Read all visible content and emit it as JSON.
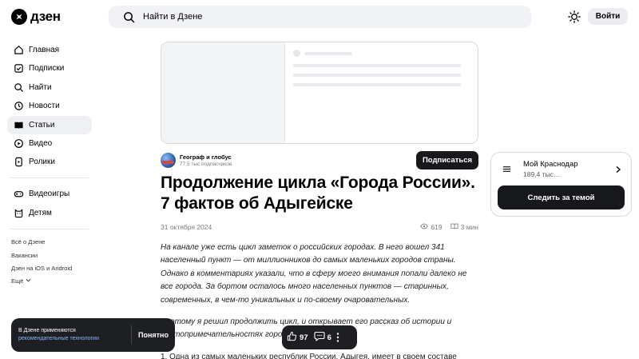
{
  "header": {
    "logo_text": "дзен",
    "search_placeholder": "Найти в Дзене",
    "login_label": "Войти"
  },
  "sidebar": {
    "items": [
      {
        "label": "Главная",
        "icon": "home-icon"
      },
      {
        "label": "Подписки",
        "icon": "subscriptions-icon"
      },
      {
        "label": "Найти",
        "icon": "search-icon"
      },
      {
        "label": "Новости",
        "icon": "news-icon"
      },
      {
        "label": "Статьи",
        "icon": "articles-icon",
        "active": true
      },
      {
        "label": "Видео",
        "icon": "video-icon"
      },
      {
        "label": "Ролики",
        "icon": "shorts-icon"
      }
    ],
    "items2": [
      {
        "label": "Видеоигры",
        "icon": "gamepad-icon"
      },
      {
        "label": "Детям",
        "icon": "kids-icon"
      }
    ],
    "footer": [
      "Всё о Дзене",
      "Вакансии",
      "Дзен на iOS и Android",
      "Ещё"
    ]
  },
  "channel": {
    "name": "Географ и глобус",
    "subscribers": "77,5 тыс подписчиков",
    "subscribe_label": "Подписаться"
  },
  "article": {
    "title": "Продолжение цикла «Города России». 7 фактов об Адыгейске",
    "date": "31 октября 2024",
    "views": "619",
    "read_time": "3 мин",
    "paragraphs": [
      "На канале уже есть цикл заметок о российских городах. В него вошел 341 населенный пункт — от миллионников до самых маленьких городов страны. Однако в комментариях указали, что в сферу моего внимания попали далеко не все города. За бортом осталось много населенных пунктов — старинных, современных, в чем-то уникальных и по-своему очаровательных.",
      "Поэтому я решил продолжить цикл, и открывает его рассказ об истории и достопримечательностях городов...",
      "1. Одна из самых маленьких республик России, Адыгея, имеет в своем составе"
    ]
  },
  "topic": {
    "name": "Мой Краснодар",
    "count": "189,4 тыс…",
    "follow_label": "Следить за темой"
  },
  "cookie": {
    "text": "В Дзене применяются",
    "link": "рекомендательные технологии",
    "button": "Понятно"
  },
  "reactions": {
    "likes": "97",
    "comments": "6"
  }
}
